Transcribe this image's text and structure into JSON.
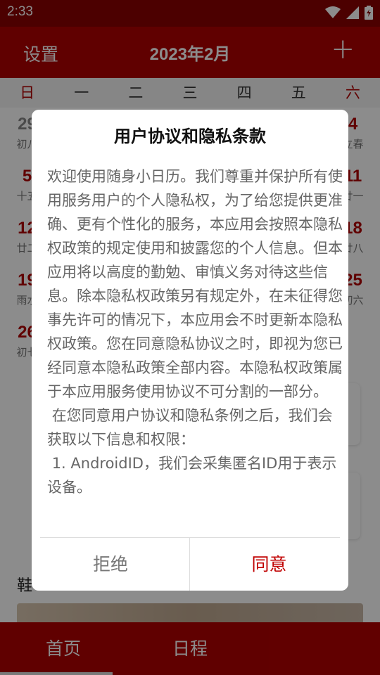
{
  "status_bar": {
    "time": "2:33"
  },
  "toolbar": {
    "settings_label": "设置",
    "title": "2023年2月",
    "add_label": "+"
  },
  "weekdays": [
    "日",
    "一",
    "二",
    "三",
    "四",
    "五",
    "六"
  ],
  "calendar": {
    "rows": [
      {
        "left": {
          "num": "29",
          "sub": "初八"
        },
        "right": {
          "num": "4",
          "sub": "立春"
        }
      },
      {
        "left": {
          "num": "5",
          "sub": "十五"
        },
        "right": {
          "num": "11",
          "sub": "廿一"
        }
      },
      {
        "left": {
          "num": "12",
          "sub": "廿二"
        },
        "right": {
          "num": "18",
          "sub": "廿八"
        }
      },
      {
        "left": {
          "num": "19",
          "sub": "雨水"
        },
        "right": {
          "num": "25",
          "sub": "初六"
        }
      },
      {
        "left": {
          "num": "26",
          "sub": "初七"
        },
        "right": {
          "num": "",
          "sub": ""
        }
      }
    ]
  },
  "section": {
    "title": "鞋"
  },
  "bottom_nav": {
    "home_label": "首页",
    "schedule_label": "日程"
  },
  "dialog": {
    "title": "用户协议和隐私条款",
    "body": "欢迎使用随身小日历。我们尊重并保护所有使用服务用户的个人隐私权，为了给您提供更准确、更有个性化的服务，本应用会按照本隐私权政策的规定使用和披露您的个人信息。但本应用将以高度的勤勉、审慎义务对待这些信息。除本隐私权政策另有规定外，在未征得您事先许可的情况下，本应用会不时更新本隐私权政策。您在同意隐私协议之时，即视为您已经同意本隐私政策全部内容。本隐私权政策属于本应用服务使用协议不可分割的一部分。\n 在您同意用户协议和隐私条例之后，我们会获取以下信息和权限：\n 1. AndroidID，我们会采集匿名ID用于表示设备。",
    "reject_label": "拒绝",
    "agree_label": "同意"
  },
  "colors": {
    "primary": "#b00000",
    "status_bar": "#8b0000",
    "accent_text": "#c00000"
  }
}
